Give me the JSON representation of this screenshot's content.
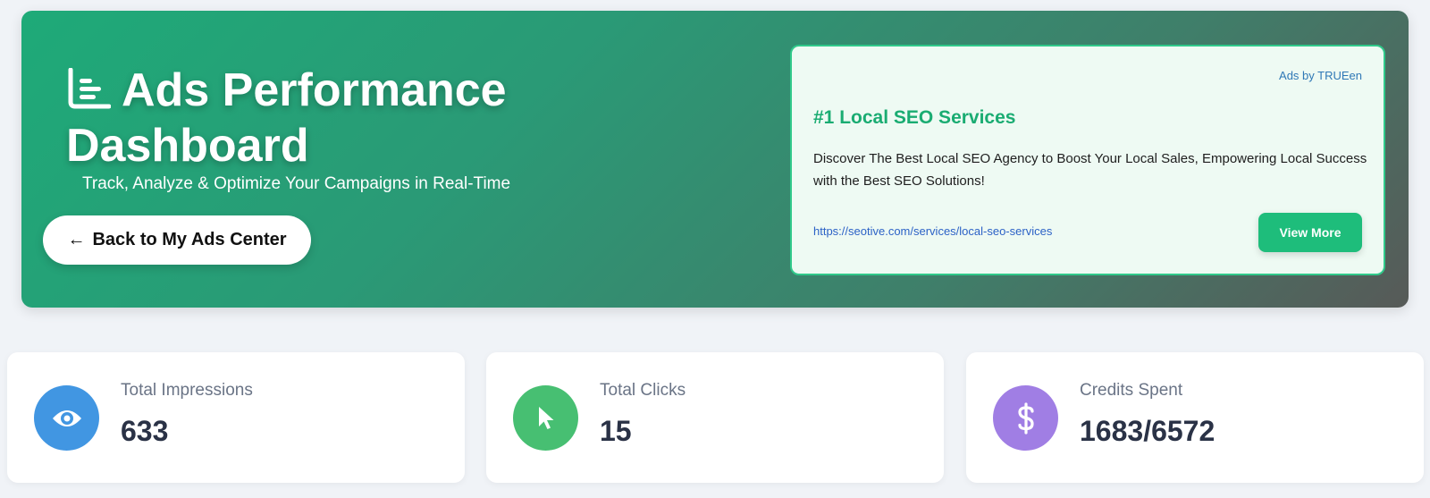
{
  "hero": {
    "title": "Ads Performance Dashboard",
    "subtitle": "Track, Analyze & Optimize Your Campaigns in Real-Time",
    "back_button_label": "Back to My Ads Center",
    "back_icon": "←"
  },
  "ad": {
    "attribution": "Ads by TRUEen",
    "title": "#1 Local SEO Services",
    "description": "Discover The Best Local SEO Agency to Boost Your Local Sales, Empowering Local Success with the Best SEO Solutions!",
    "link": "https://seotive.com/services/local-seo-services",
    "cta_label": "View More"
  },
  "stats": [
    {
      "label": "Total Impressions",
      "value": "633",
      "icon": "eye-icon",
      "color": "#4196e2"
    },
    {
      "label": "Total Clicks",
      "value": "15",
      "icon": "cursor-icon",
      "color": "#47bf72"
    },
    {
      "label": "Credits Spent",
      "value": "1683/6572",
      "icon": "dollar-icon",
      "color": "#a07ee4"
    }
  ],
  "colors": {
    "hero_start": "#1eaa78",
    "hero_end": "#575a58",
    "ad_accent": "#1ebd7b",
    "link": "#2c62c6"
  }
}
